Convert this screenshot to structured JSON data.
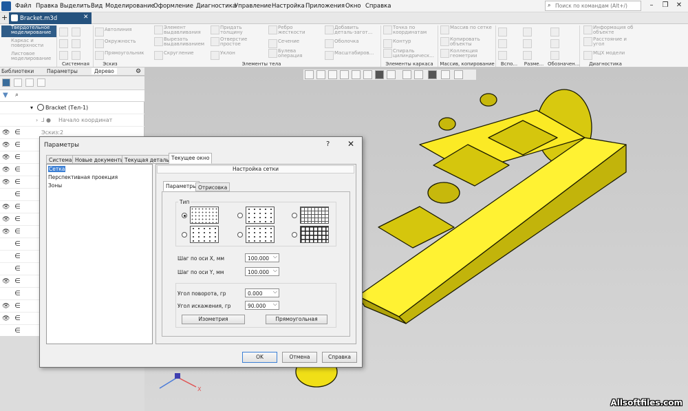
{
  "menu": [
    "Файл",
    "Правка",
    "Выделить",
    "Вид",
    "Моделирование",
    "Оформление",
    "Диагностика",
    "Управление",
    "Настройка",
    "Приложения",
    "Окно",
    "Справка"
  ],
  "search": {
    "placeholder": "Поиск по командам (Alt+/)"
  },
  "doc_tab": "Bracket.m3d",
  "modes": [
    "Твердотельное моделирование",
    "Каркас и поверхности",
    "Листовое моделирование"
  ],
  "tools": {
    "c1": [
      "Автолиния",
      "Окружность",
      "Прямоугольник"
    ],
    "c2": [
      "Элемент выдавливания",
      "Вырезать выдавливанием",
      "Скругление"
    ],
    "c3": [
      "Придать толщину",
      "Отверстие простое",
      "Уклон"
    ],
    "c4": [
      "Ребро жесткости",
      "Сечение",
      "Булева операция"
    ],
    "c5": [
      "Добавить деталь-загот...",
      "Оболочка",
      "Масштабиров..."
    ],
    "c6": [
      "Точка по координатам",
      "Контур",
      "Спираль цилиндрическ..."
    ],
    "c7": [
      "Массив по сетке",
      "Копировать объекты",
      "Коллекция геометрии"
    ],
    "c8": [
      "Информация об объекте",
      "Расстояние и угол",
      "МЦХ модели"
    ]
  },
  "groups": [
    "Системная",
    "Эскиз",
    "Элементы тела",
    "Элементы каркаса",
    "Массив, копирование",
    "Вспо...",
    "Разме...",
    "Обозначен...",
    "Диагностика"
  ],
  "panel_tabs": [
    "Библиотеки",
    "Параметры",
    "Дерево"
  ],
  "tree": {
    "root": "Bracket (Тел-1)",
    "origin": "Начало координат",
    "sketch": "Эскиз:2"
  },
  "dialog": {
    "title": "Параметры",
    "help": "?",
    "close": "✕",
    "tabs": [
      "Система",
      "Новые документы",
      "Текущая деталь",
      "Текущее окно"
    ],
    "categories": [
      "Сетка",
      "Перспективная проекция",
      "Зоны"
    ],
    "header": "Настройка сетки",
    "subtabs": [
      "Параметры",
      "Отрисовка"
    ],
    "type_label": "Тип",
    "step_x_label": "Шаг по оси X, мм",
    "step_x": "100.000",
    "step_y_label": "Шаг по оси Y, мм",
    "step_y": "100.000",
    "rotation_label": "Угол поворота, гр",
    "rotation": "0.000",
    "distortion_label": "Угол искажения, гр",
    "distortion": "90.000",
    "btn_iso": "Изометрия",
    "btn_rect": "Прямоугольная",
    "ok": "OK",
    "cancel": "Отмена",
    "helpbtn": "Справка"
  },
  "axes": {
    "x": "X"
  },
  "watermark": "Allsoftfiles.com",
  "colors": {
    "accent": "#2f5c88",
    "model": "#f5e51c",
    "selection": "#3b7fd4"
  }
}
